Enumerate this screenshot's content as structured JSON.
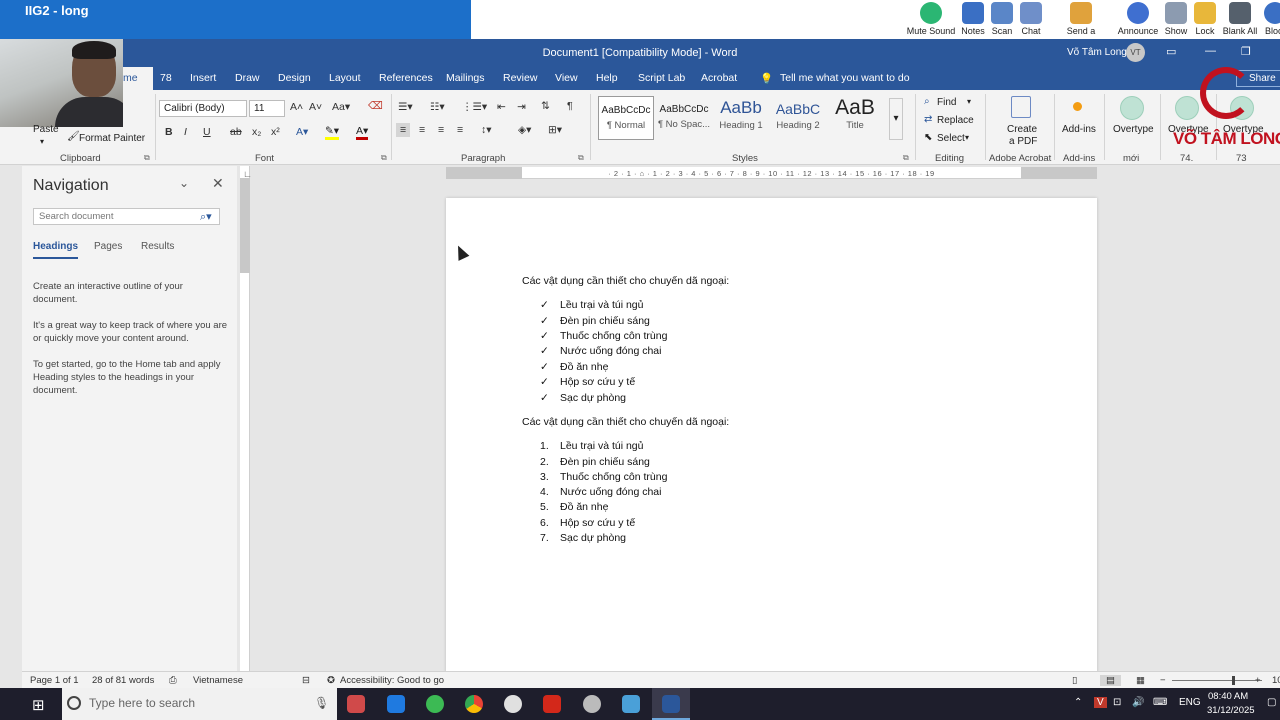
{
  "remote_bar": {
    "title": "IIG2 - long",
    "tools": [
      {
        "label": "Mute Sound",
        "icon": "speaker-icon",
        "color": "#2bb673"
      },
      {
        "label": "Notes",
        "icon": "notes-icon",
        "color": "#3a6fc4"
      },
      {
        "label": "Scan",
        "icon": "scan-icon",
        "color": "#5a86c8"
      },
      {
        "label": "Chat",
        "icon": "chat-icon",
        "color": "#6f8fc9"
      },
      {
        "label": "Send a message",
        "icon": "envelope-icon",
        "color": "#e0a23c"
      },
      {
        "label": "Announce",
        "icon": "microphone-icon",
        "color": "#3f6fd0"
      },
      {
        "label": "Show",
        "icon": "show-icon",
        "color": "#8c9bb0"
      },
      {
        "label": "Lock",
        "icon": "lock-icon",
        "color": "#e8b73a"
      },
      {
        "label": "Blank All",
        "icon": "monitor-icon",
        "color": "#55606c"
      },
      {
        "label": "Block",
        "icon": "globe-icon",
        "color": "#3a6fc4"
      }
    ]
  },
  "window": {
    "title": "Document1 [Compatibility Mode] - Word",
    "user_name": "Võ Tâm Long",
    "user_initials": "VT",
    "accent": "#2b579a"
  },
  "tabs": {
    "home": "me",
    "items": [
      "78",
      "Insert",
      "Draw",
      "Design",
      "Layout",
      "References",
      "Mailings",
      "Review",
      "View",
      "Help",
      "Script Lab",
      "Acrobat"
    ],
    "tell_me": "Tell me what you want to do",
    "share": "Share"
  },
  "ribbon": {
    "clipboard": {
      "paste": "Paste",
      "format_painter": "Format Painter",
      "label": "Clipboard"
    },
    "font": {
      "name": "Calibri (Body)",
      "size": "11",
      "label": "Font",
      "color_red": "#c00000",
      "highlight": "#ffff00"
    },
    "paragraph": {
      "label": "Paragraph"
    },
    "styles": {
      "label": "Styles",
      "items": [
        {
          "sample": "AaBbCcDc",
          "name": "¶ Normal"
        },
        {
          "sample": "AaBbCcDc",
          "name": "¶ No Spac..."
        },
        {
          "sample": "AaBb",
          "name": "Heading 1"
        },
        {
          "sample": "AaBbC",
          "name": "Heading 2"
        },
        {
          "sample": "AaB",
          "name": "Title"
        }
      ]
    },
    "editing": {
      "find": "Find",
      "replace": "Replace",
      "select": "Select",
      "label": "Editing"
    },
    "acrobat": {
      "create_pdf_line1": "Create",
      "create_pdf_line2": "a PDF",
      "label": "Adobe Acrobat"
    },
    "addins": {
      "button": "Add-ins",
      "label": "Add-ins"
    },
    "overtype": {
      "button": "Overtype",
      "group": "mới"
    },
    "extra": [
      {
        "button": "Overtype",
        "group": "74."
      },
      {
        "button": "Overtype",
        "group": "73"
      }
    ]
  },
  "navigation": {
    "title": "Navigation",
    "search_placeholder": "Search document",
    "tabs": [
      "Headings",
      "Pages",
      "Results"
    ],
    "message1": "Create an interactive outline of your document.",
    "message2": "It's a great way to keep track of where you are or quickly move your content around.",
    "message3": "To get started, go to the Home tab and apply Heading styles to the headings in your document."
  },
  "ruler": {
    "ticks": "· 2 · 1 · ⌂ · 1 · 2 · 3 · 4 · 5 · 6 · 7 · 8 · 9 · 10 · 11 · 12 · 13 · 14 · 15 · 16 · 17 · 18 · 19"
  },
  "document": {
    "heading1": "Các vật dụng cần thiết cho chuyến dã ngoại:",
    "checklist": [
      "Lều trại và túi ngủ",
      "Đèn pin chiếu sáng",
      "Thuốc chống côn trùng",
      "Nước uống đóng chai",
      "Đồ ăn nhẹ",
      "Hộp sơ cứu y tế",
      "Sạc dự phòng"
    ],
    "heading2": "Các vật dụng cần thiết cho chuyến dã ngoại:",
    "numbered": [
      {
        "num": "1.",
        "text": "Lều trại và túi ngủ"
      },
      {
        "num": "2.",
        "text": "Đèn pin chiếu sáng"
      },
      {
        "num": "3.",
        "text": "Thuốc chống côn trùng"
      },
      {
        "num": "4.",
        "text": "Nước uống đóng chai"
      },
      {
        "num": "5.",
        "text": "Đồ ăn nhẹ"
      },
      {
        "num": "6.",
        "text": "Hộp sơ cứu y tế"
      },
      {
        "num": "7.",
        "text": "Sạc dự phòng"
      }
    ],
    "check_mark": "✓"
  },
  "status": {
    "page": "Page 1 of 1",
    "words": "28 of 81 words",
    "language": "Vietnamese",
    "accessibility": "Accessibility: Good to go",
    "zoom_minus": "−",
    "zoom_plus": "+",
    "zoom_partial": "10"
  },
  "taskbar": {
    "search_placeholder": "Type here to search",
    "language": "ENG",
    "time": "08:40 AM",
    "date": "31/12/2025",
    "apps": [
      {
        "icon": "app-icon-1",
        "color": "#d04a4a"
      },
      {
        "icon": "app-icon-2",
        "color": "#1f7ae0"
      },
      {
        "icon": "app-icon-3",
        "color": "#3cba54"
      },
      {
        "icon": "chrome-icon",
        "color": "#e8b23a"
      },
      {
        "icon": "app-icon-5",
        "color": "#e0e0e0"
      },
      {
        "icon": "acrobat-icon",
        "color": "#d3281a"
      },
      {
        "icon": "app-icon-7",
        "color": "#bbbbbb"
      },
      {
        "icon": "app-icon-8",
        "color": "#4aa0d8"
      },
      {
        "icon": "word-icon",
        "color": "#2b579a"
      }
    ]
  },
  "overlay": {
    "logo_text": "VÕ TÂM LONG"
  }
}
